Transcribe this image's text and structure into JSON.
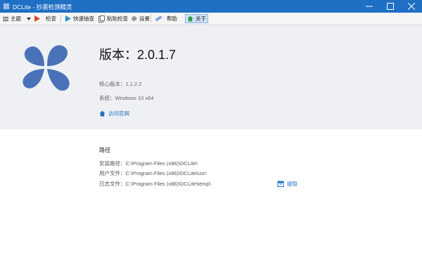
{
  "window": {
    "title": "DCLite - 抄袭检测精灵",
    "controls": {
      "minimize_icon": "minimize-icon",
      "maximize_icon": "maximize-icon",
      "close_icon": "close-icon"
    }
  },
  "toolbar": {
    "items": [
      {
        "label": "主题",
        "icon": "hamburger-icon"
      },
      {
        "label": "检查",
        "icon": "play-icon"
      },
      {
        "label": "快速抽查",
        "icon": "play-icon"
      },
      {
        "label": "粘贴检查",
        "icon": "paste-icon"
      },
      {
        "label": "设置",
        "icon": "gear-icon"
      },
      {
        "label": "帮助",
        "icon": "link-icon"
      },
      {
        "label": "关于",
        "icon": "home-icon",
        "active": true
      }
    ]
  },
  "about": {
    "version": "版本：2.0.1.7",
    "core_version": "核心版本：1.1.2.2",
    "system": "系统：Windows 10 x64",
    "website_link": "访问官网"
  },
  "paths": {
    "section_title": "路径",
    "rows": [
      {
        "label": "安装路径：",
        "value": "C:\\Program Files (x86)\\DCLite\\"
      },
      {
        "label": "用户文件：",
        "value": "C:\\Program Files (x86)\\DCLite\\usr\\"
      },
      {
        "label": "日志文件：",
        "value": "C:\\Program Files (x86)\\DCLite\\temp\\"
      }
    ],
    "extract_label": "提取"
  },
  "colors": {
    "titlebar": "#1f6fc4",
    "logo": "#4a72b8",
    "accent_red": "#d9442c",
    "accent_blue": "#1f6fc4",
    "accent_green": "#2e9e47",
    "hero_bg": "#eef0f3"
  }
}
